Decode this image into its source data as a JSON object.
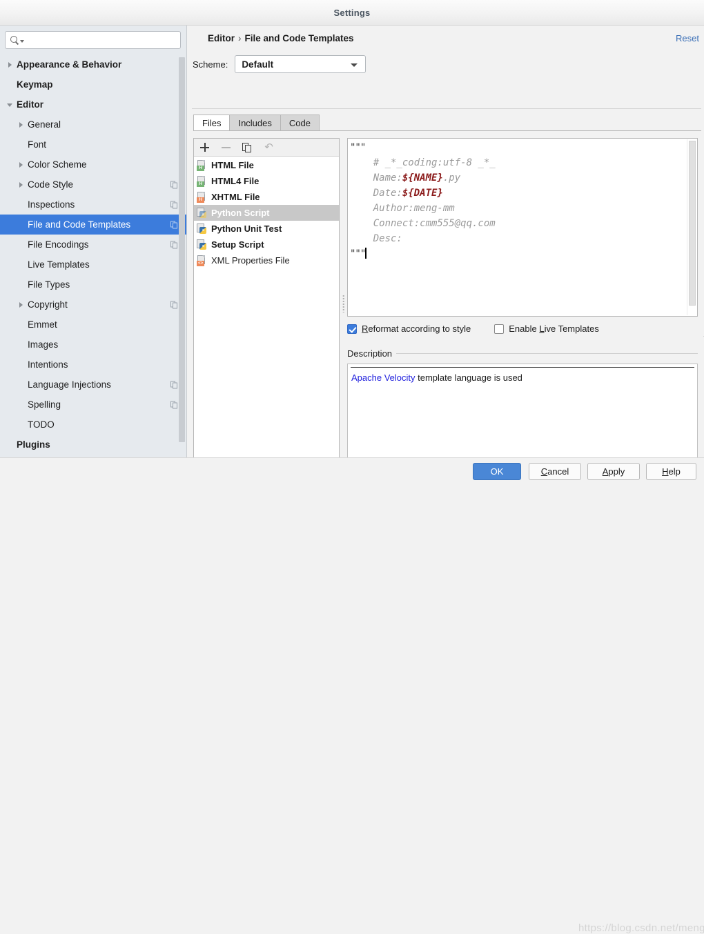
{
  "window": {
    "title": "Settings"
  },
  "sidebar": {
    "search": {
      "value": "",
      "placeholder": ""
    },
    "items": [
      {
        "label": "Appearance & Behavior",
        "indent": 0,
        "twisty": "closed",
        "bold": true,
        "badge": false,
        "selected": false
      },
      {
        "label": "Keymap",
        "indent": 0,
        "twisty": "none",
        "bold": true,
        "badge": false,
        "selected": false
      },
      {
        "label": "Editor",
        "indent": 0,
        "twisty": "open",
        "bold": true,
        "badge": false,
        "selected": false
      },
      {
        "label": "General",
        "indent": 1,
        "twisty": "closed",
        "bold": false,
        "badge": false,
        "selected": false
      },
      {
        "label": "Font",
        "indent": 1,
        "twisty": "none",
        "bold": false,
        "badge": false,
        "selected": false
      },
      {
        "label": "Color Scheme",
        "indent": 1,
        "twisty": "closed",
        "bold": false,
        "badge": false,
        "selected": false
      },
      {
        "label": "Code Style",
        "indent": 1,
        "twisty": "closed",
        "bold": false,
        "badge": true,
        "selected": false
      },
      {
        "label": "Inspections",
        "indent": 1,
        "twisty": "none",
        "bold": false,
        "badge": true,
        "selected": false
      },
      {
        "label": "File and Code Templates",
        "indent": 1,
        "twisty": "none",
        "bold": false,
        "badge": true,
        "selected": true
      },
      {
        "label": "File Encodings",
        "indent": 1,
        "twisty": "none",
        "bold": false,
        "badge": true,
        "selected": false
      },
      {
        "label": "Live Templates",
        "indent": 1,
        "twisty": "none",
        "bold": false,
        "badge": false,
        "selected": false
      },
      {
        "label": "File Types",
        "indent": 1,
        "twisty": "none",
        "bold": false,
        "badge": false,
        "selected": false
      },
      {
        "label": "Copyright",
        "indent": 1,
        "twisty": "closed",
        "bold": false,
        "badge": true,
        "selected": false
      },
      {
        "label": "Emmet",
        "indent": 1,
        "twisty": "none",
        "bold": false,
        "badge": false,
        "selected": false
      },
      {
        "label": "Images",
        "indent": 1,
        "twisty": "none",
        "bold": false,
        "badge": false,
        "selected": false
      },
      {
        "label": "Intentions",
        "indent": 1,
        "twisty": "none",
        "bold": false,
        "badge": false,
        "selected": false
      },
      {
        "label": "Language Injections",
        "indent": 1,
        "twisty": "none",
        "bold": false,
        "badge": true,
        "selected": false
      },
      {
        "label": "Spelling",
        "indent": 1,
        "twisty": "none",
        "bold": false,
        "badge": true,
        "selected": false
      },
      {
        "label": "TODO",
        "indent": 1,
        "twisty": "none",
        "bold": false,
        "badge": false,
        "selected": false
      },
      {
        "label": "Plugins",
        "indent": 0,
        "twisty": "none",
        "bold": true,
        "badge": false,
        "selected": false
      }
    ]
  },
  "header": {
    "breadcrumb_root": "Editor",
    "breadcrumb_sep": "›",
    "breadcrumb_leaf": "File and Code Templates",
    "reset_label": "Reset",
    "scheme_label": "Scheme:",
    "scheme_value": "Default"
  },
  "tabs": [
    {
      "label": "Files",
      "active": true
    },
    {
      "label": "Includes",
      "active": false
    },
    {
      "label": "Code",
      "active": false
    }
  ],
  "list_toolbar": {
    "add": "add-icon",
    "remove": "remove-icon",
    "copy": "copy-icon",
    "reset": "undo-icon"
  },
  "templates": [
    {
      "label": "HTML File",
      "icon": "html-file-icon",
      "badge_text": "H",
      "badge_color": "green",
      "selected": false,
      "bold": true
    },
    {
      "label": "HTML4 File",
      "icon": "html4-file-icon",
      "badge_text": "H",
      "badge_color": "green",
      "selected": false,
      "bold": true
    },
    {
      "label": "XHTML File",
      "icon": "xhtml-file-icon",
      "badge_text": "H",
      "badge_color": "orange",
      "selected": false,
      "bold": true
    },
    {
      "label": "Python Script",
      "icon": "python-file-icon",
      "badge_text": "",
      "badge_color": "python",
      "selected": true,
      "bold": true
    },
    {
      "label": "Python Unit Test",
      "icon": "python-file-icon",
      "badge_text": "",
      "badge_color": "python",
      "selected": false,
      "bold": true
    },
    {
      "label": "Setup Script",
      "icon": "python-file-icon",
      "badge_text": "",
      "badge_color": "python",
      "selected": false,
      "bold": true
    },
    {
      "label": "XML Properties File",
      "icon": "xml-file-icon",
      "badge_text": "<>",
      "badge_color": "xml",
      "selected": false,
      "bold": false
    }
  ],
  "editor": {
    "line1": "\"\"\"",
    "line2_prefix": "    # _*_coding:utf-8 _*_",
    "line3_label": "    Name:",
    "line3_var": "${NAME}",
    "line3_suffix": ".py",
    "line4_label": "    Date:",
    "line4_var": "${DATE}",
    "line5": "    Author:meng-mm",
    "line6": "    Connect:cmm555@qq.com",
    "line7": "    Desc:",
    "line8": "\"\"\""
  },
  "options": {
    "reformat": {
      "label_pre": "",
      "label_underlined": "R",
      "label_post": "eformat according to style",
      "checked": true
    },
    "live_templates": {
      "label_pre": "Enable ",
      "label_underlined": "L",
      "label_post": "ive Templates",
      "checked": false
    }
  },
  "description": {
    "group_title": "Description",
    "link_text": "Apache Velocity",
    "rest_text": " template language is used"
  },
  "footer": {
    "ok": "OK",
    "cancel_pre": "",
    "cancel_underlined": "C",
    "cancel_post": "ancel",
    "apply_pre": "",
    "apply_underlined": "A",
    "apply_post": "pply",
    "help_pre": "",
    "help_underlined": "H",
    "help_post": "elp",
    "watermark": "https://blog.csdn.net/mengmeng"
  },
  "colors": {
    "accent_blue": "#3c7cdc",
    "link_blue": "#3b6fb6",
    "velocity_link": "#2020dd",
    "template_var": "#8b1a1a",
    "sidebar_bg": "#e6eaee"
  }
}
